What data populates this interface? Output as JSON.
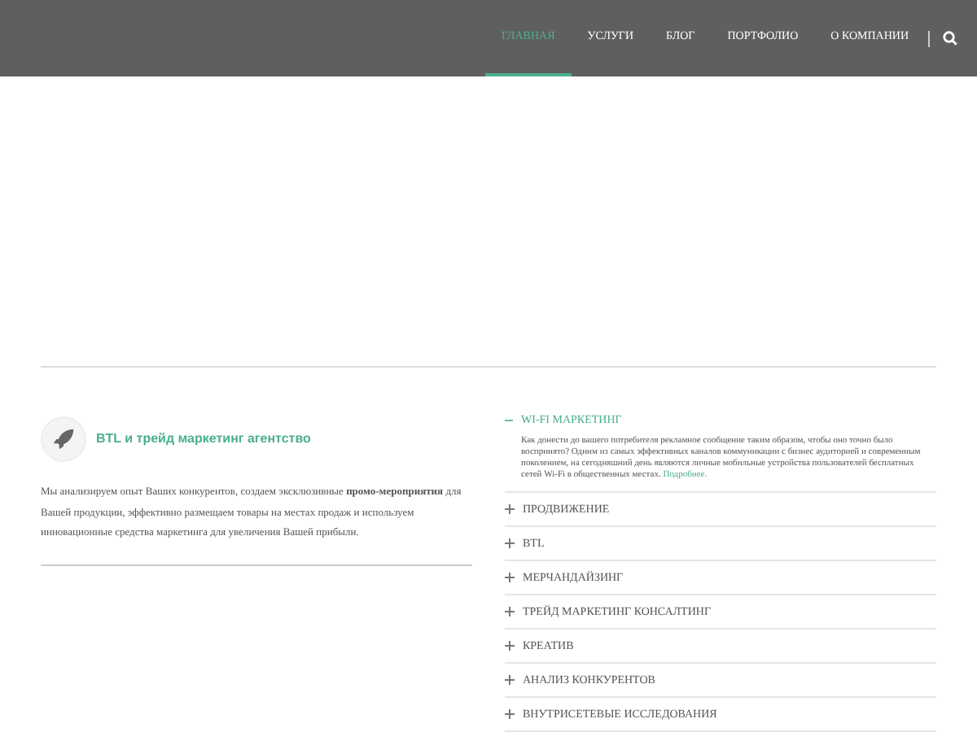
{
  "nav": {
    "items": [
      {
        "label": "ГЛАВНАЯ",
        "selected": true
      },
      {
        "label": "УСЛУГИ",
        "selected": false
      },
      {
        "label": "БЛОГ",
        "selected": false
      },
      {
        "label": "ПОРТФОЛИО",
        "selected": false
      },
      {
        "label": "О КОМПАНИИ",
        "selected": false
      }
    ]
  },
  "intro": {
    "title": "BTL и трейд маркетинг агентство",
    "text": "Мы анализируем опыт Ваших конкурентов, создаем эксклюзивные **промо-мероприятия** для Вашей продукции, эффективно размещаем товары на местах продаж и используем инновационные средства маркетинга для увеличения Вашей прибыли."
  },
  "accordion": [
    {
      "title": "WI-FI МАРКЕТИНГ",
      "expanded": true,
      "text": "Как донести до вашего потребителя рекламное сообщение таким образом, чтобы оно точно было воспринято? Одним из самых эффективных каналов коммуникации с бизнес аудиторией и современным поколением, на сегодняшний день являются личные мобильные устройства пользователей бесплатных сетей Wi-Fi в общественных местах.",
      "link": "Подробнее."
    },
    {
      "title": "ПРОДВИЖЕНИЕ",
      "expanded": false
    },
    {
      "title": "BTL",
      "expanded": false
    },
    {
      "title": "МЕРЧАНДАЙЗИНГ",
      "expanded": false
    },
    {
      "title": "ТРЕЙД МАРКЕТИНГ КОНСАЛТИНГ",
      "expanded": false
    },
    {
      "title": "КРЕАТИВ",
      "expanded": false
    },
    {
      "title": "АНАЛИЗ КОНКУРЕНТОВ",
      "expanded": false
    },
    {
      "title": "ВНУТРИСЕТЕВЫЕ ИССЛЕДОВАНИЯ",
      "expanded": false
    }
  ]
}
